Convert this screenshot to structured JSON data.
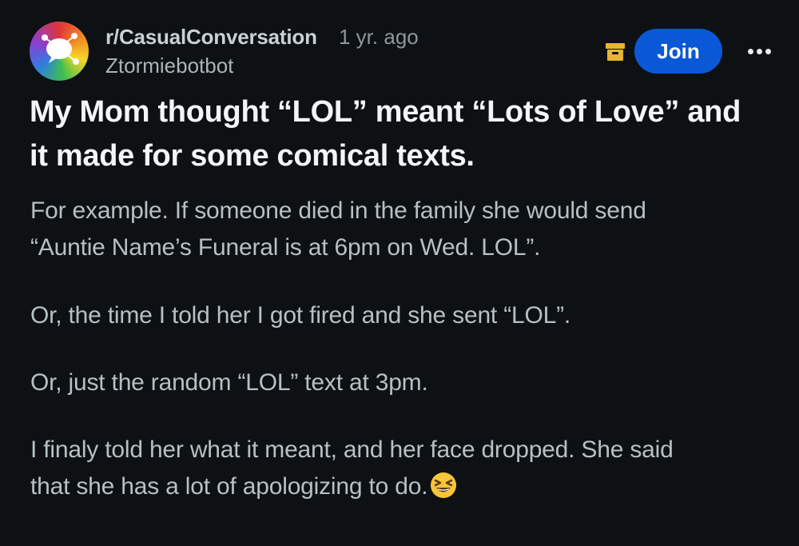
{
  "post": {
    "subreddit": "r/CasualConversation",
    "time_ago": "1 yr. ago",
    "username": "Ztormiebotbot",
    "join_label": "Join",
    "title_line1": "My Mom thought “LOL” meant “Lots of Love” and",
    "title_line2": "it made for some comical texts.",
    "body": [
      "For example. If someone died in the family she would send",
      "“Auntie Name’s Funeral is at 6pm on Wed. LOL”.",
      "Or, the time I told her I got fired and she sent “LOL”.",
      "Or, just the random “LOL” text at 3pm.",
      "I finaly told her what it meant, and her face dropped. She said",
      "that she has a lot of apologizing to do."
    ]
  },
  "icons": {
    "avatar": "subreddit-avatar",
    "archive": "archive-icon",
    "more": "more-options-icon",
    "emoji": "grinning-squinting-face-emoji"
  },
  "colors": {
    "background": "#0e1113",
    "join_button": "#0a58d6",
    "archive_icon": "#e8b62b",
    "title_text": "#f2f5f6",
    "body_text": "#b6c0c6"
  }
}
